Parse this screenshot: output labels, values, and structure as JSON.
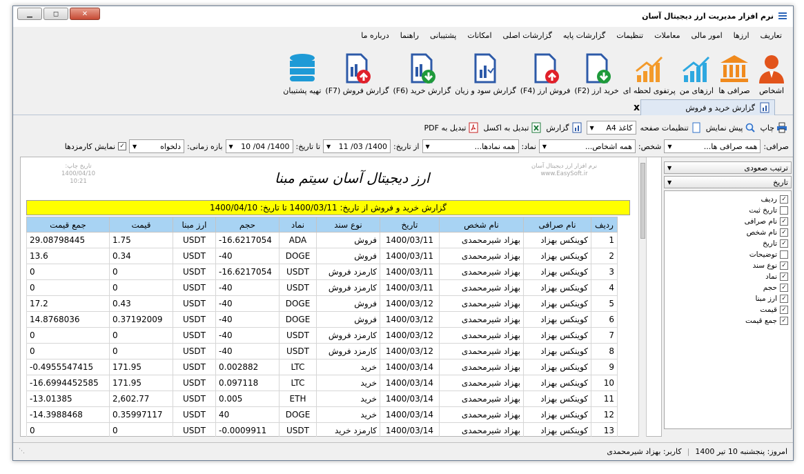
{
  "title": "نرم افزار مدیریت ارز دیجیتال آسان",
  "menu": [
    "تعاریف",
    "ارزها",
    "امور مالی",
    "معاملات",
    "تنظیمات",
    "گزارشات پایه",
    "گزارشات اصلی",
    "امکانات",
    "پشتیبانی",
    "راهنما",
    "درباره ما"
  ],
  "ribbon": [
    "اشخاص",
    "صرافی ها",
    "ارزهای من",
    "پرتفوی لحظه ای",
    "خرید ارز (F2)",
    "فروش ارز (F4)",
    "گزارش سود و زیان",
    "گزارش خرید (F6)",
    "گزارش فروش (F7)",
    "تهیه پشتیبان"
  ],
  "tab": {
    "label": "گزارش خرید و فروش",
    "close": "x"
  },
  "toolbar": {
    "print": "چاپ",
    "preview": "پیش نمایش",
    "page_settings": "تنظیمات صفحه",
    "paper": "کاغذ A4",
    "report": "گزارش",
    "excel": "تبدیل به اکسل",
    "pdf": "تبدیل به PDF"
  },
  "filters": {
    "exchange_label": "صرافی:",
    "exchange": "همه صرافی ها...",
    "person_label": "شخص:",
    "person": "همه اشخاص...",
    "symbol_label": "نماد:",
    "symbol": "همه نمادها...",
    "from_label": "از تاریخ:",
    "from": "1400/ 03/ 11",
    "to_label": "تا تاریخ:",
    "to": "1400/ 04/ 10",
    "period_label": "بازه زمانی:",
    "period": "دلخواه",
    "fees_label": "نمایش کارمزدها"
  },
  "sidepanel": {
    "sort": "ترتیب صعودی",
    "sortby": "تاریخ",
    "columns": [
      {
        "label": "ردیف",
        "checked": true
      },
      {
        "label": "تاریخ ثبت",
        "checked": false
      },
      {
        "label": "نام صرافی",
        "checked": true
      },
      {
        "label": "نام شخص",
        "checked": true
      },
      {
        "label": "تاریخ",
        "checked": true
      },
      {
        "label": "توضیحات",
        "checked": false
      },
      {
        "label": "نوع سند",
        "checked": true
      },
      {
        "label": "نماد",
        "checked": true
      },
      {
        "label": "حجم",
        "checked": true
      },
      {
        "label": "ارز مبنا",
        "checked": true
      },
      {
        "label": "قیمت",
        "checked": true
      },
      {
        "label": "جمع قیمت",
        "checked": true
      }
    ]
  },
  "report": {
    "print_date_label": "تاریخ چاپ:",
    "print_date": "1400/04/10",
    "print_time": "10:21",
    "company": "ارز دیجیتال آسان سیتم مبنا",
    "soft_name": "نرم افزار ارز دیجیتال آسان",
    "soft_site": "www.EasySoft.ir",
    "title": "گزارش خرید و فروش از تاریخ: 1400/03/11 تا تاریخ: 1400/04/10",
    "headers": [
      "ردیف",
      "نام صرافی",
      "نام شخص",
      "تاریخ",
      "نوع سند",
      "نماد",
      "حجم",
      "ارز مبنا",
      "قیمت",
      "جمع قیمت"
    ],
    "rows": [
      [
        "1",
        "کوینکس بهزاد",
        "بهزاد شیرمحمدی",
        "1400/03/11",
        "فروش",
        "ADA",
        "-16.6217054",
        "USDT",
        "1.75",
        "29.08798445"
      ],
      [
        "2",
        "کوینکس بهزاد",
        "بهزاد شیرمحمدی",
        "1400/03/11",
        "فروش",
        "DOGE",
        "-40",
        "USDT",
        "0.34",
        "13.6"
      ],
      [
        "3",
        "کوینکس بهزاد",
        "بهزاد شیرمحمدی",
        "1400/03/11",
        "کارمزد فروش",
        "USDT",
        "-16.6217054",
        "USDT",
        "0",
        "0"
      ],
      [
        "4",
        "کوینکس بهزاد",
        "بهزاد شیرمحمدی",
        "1400/03/11",
        "کارمزد فروش",
        "USDT",
        "-40",
        "USDT",
        "0",
        "0"
      ],
      [
        "5",
        "کوینکس بهزاد",
        "بهزاد شیرمحمدی",
        "1400/03/12",
        "فروش",
        "DOGE",
        "-40",
        "USDT",
        "0.43",
        "17.2"
      ],
      [
        "6",
        "کوینکس بهزاد",
        "بهزاد شیرمحمدی",
        "1400/03/12",
        "فروش",
        "DOGE",
        "-40",
        "USDT",
        "0.37192009",
        "14.8768036"
      ],
      [
        "7",
        "کوینکس بهزاد",
        "بهزاد شیرمحمدی",
        "1400/03/12",
        "کارمزد فروش",
        "USDT",
        "-40",
        "USDT",
        "0",
        "0"
      ],
      [
        "8",
        "کوینکس بهزاد",
        "بهزاد شیرمحمدی",
        "1400/03/12",
        "کارمزد فروش",
        "USDT",
        "-40",
        "USDT",
        "0",
        "0"
      ],
      [
        "9",
        "کوینکس بهزاد",
        "بهزاد شیرمحمدی",
        "1400/03/14",
        "خرید",
        "LTC",
        "0.002882",
        "USDT",
        "171.95",
        "-0.4955547415"
      ],
      [
        "10",
        "کوینکس بهزاد",
        "بهزاد شیرمحمدی",
        "1400/03/14",
        "خرید",
        "LTC",
        "0.097118",
        "USDT",
        "171.95",
        "-16.6994452585"
      ],
      [
        "11",
        "کوینکس بهزاد",
        "بهزاد شیرمحمدی",
        "1400/03/14",
        "خرید",
        "ETH",
        "0.005",
        "USDT",
        "2,602.77",
        "-13.01385"
      ],
      [
        "12",
        "کوینکس بهزاد",
        "بهزاد شیرمحمدی",
        "1400/03/14",
        "خرید",
        "DOGE",
        "40",
        "USDT",
        "0.35997117",
        "-14.3988468"
      ],
      [
        "13",
        "کوینکس بهزاد",
        "بهزاد شیرمحمدی",
        "1400/03/14",
        "کارمزد خرید",
        "USDT",
        "-0.0009911",
        "USDT",
        "0",
        "0"
      ]
    ]
  },
  "status": {
    "today": "امروز: پنجشنبه 10 تیر 1400",
    "user": "کاربر: بهزاد شیرمحمدی"
  }
}
